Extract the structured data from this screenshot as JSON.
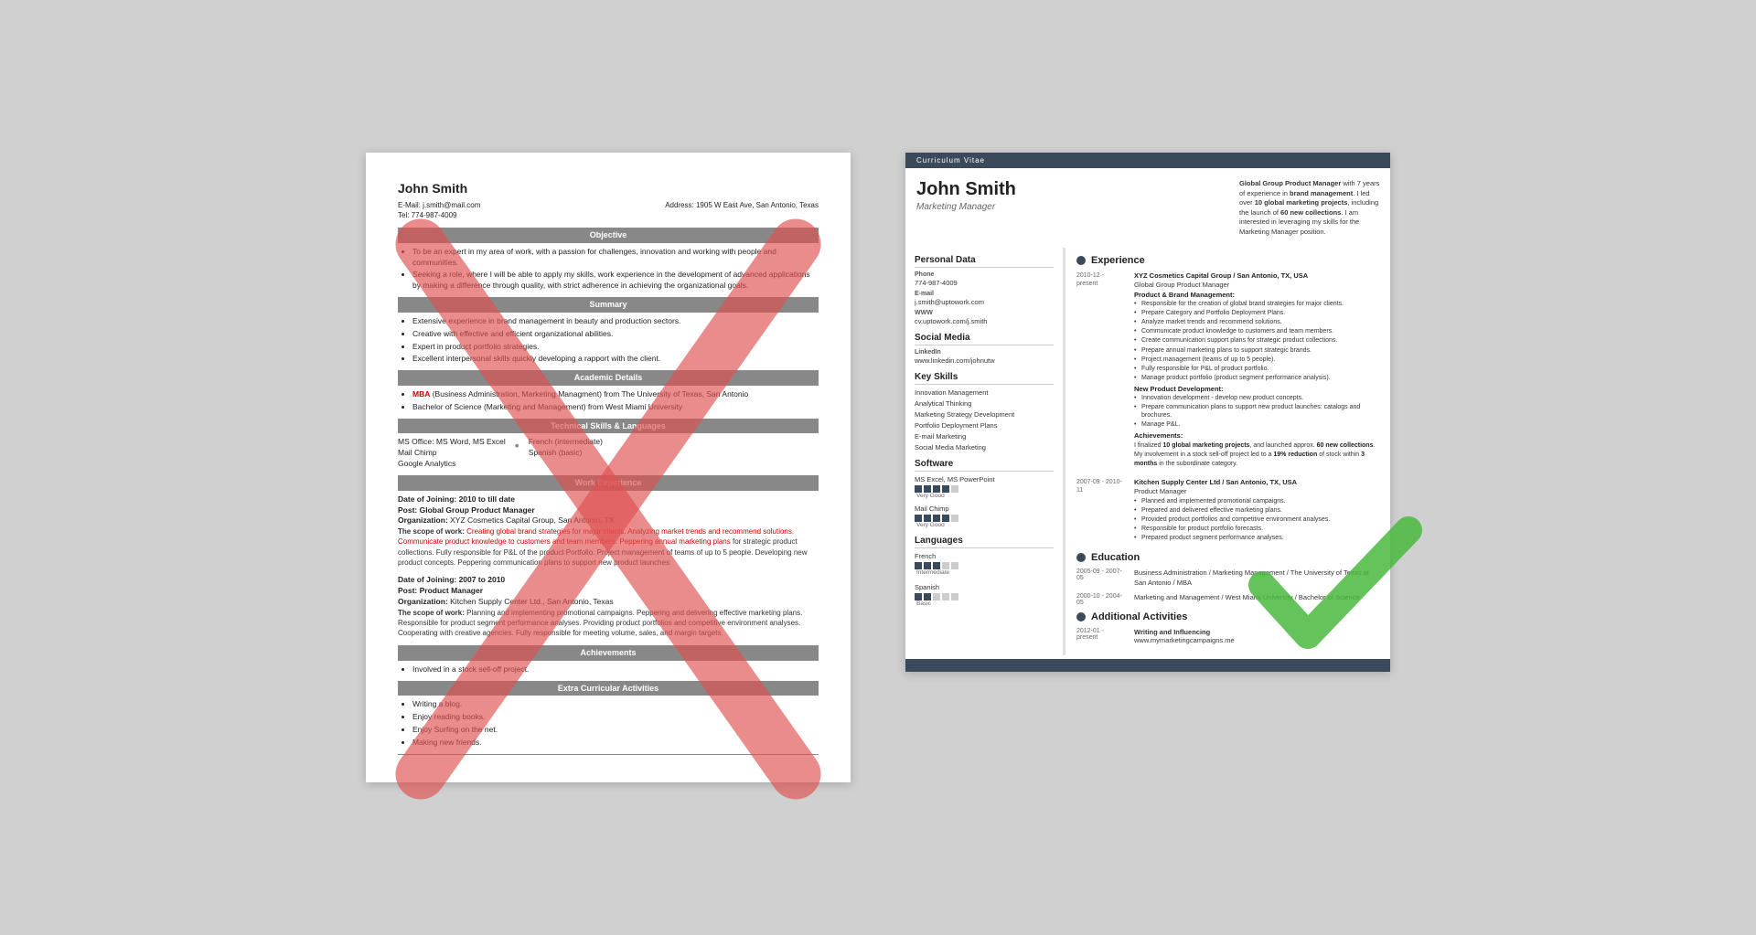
{
  "left": {
    "name": "John Smith",
    "email": "E-Mail: j.smith@mail.com",
    "tel": "Tel: 774-987-4009",
    "address": "Address: 1905 W East Ave, San Antonio, Texas",
    "sections": {
      "objective": "Objective",
      "summary": "Summary",
      "academic": "Academic Details",
      "technical": "Technical Skills & Languages",
      "work": "Work Experience",
      "achievements": "Achievements",
      "extra": "Extra Curricular Activities"
    },
    "objective_bullets": [
      "To be an expert in my area of work, with a passion for challenges, innovation and working with people and communities.",
      "Seeking a role, where I will be able to apply my skills, work experience in the development of advanced applications by making a difference through quality, with strict adherence in achieving the organizational goals."
    ],
    "summary_bullets": [
      "Extensive experience in brand management in beauty and production sectors.",
      "Creative with effective and efficient organizational abilities.",
      "Expert in product portfolio strategies.",
      "Excellent interpersonal skills quickly developing a rapport with the client."
    ],
    "academic_items": [
      {
        "text": "MBA (Business Administration, Marketing Managment) from The University of Texas, San Antonio",
        "highlight": true
      },
      {
        "text": "Bachelor of Science (Marketing and Management) from West Miami University",
        "highlight": false
      }
    ],
    "skills_left": [
      "MS Office: MS Word, MS Excel",
      "Mail Chimp",
      "Google Analytics"
    ],
    "skills_right": [
      "French (intermediate)",
      "Spanish (basic)"
    ],
    "work1": {
      "date": "Date of Joining: 2010 to till date",
      "post": "Post: Global Group Product Manager",
      "org": "Organization: XYZ Cosmetics Capital Group, San Antonio, TX",
      "scope": "The scope of work: Creating global brand strategies for major clients. Analyzing market trends and recommend solutions. Communicate product knowledge to customers and team members. Peppering annual marketing plans for strategic product collections. Fully responsible for P&L of the product Portfolio. Project management of teams of up to 5 people. Developing new product concepts. Peppering communication plans to support new product launches."
    },
    "work2": {
      "date": "Date of Joining: 2007 to 2010",
      "post": "Post: Product Manager",
      "org": "Organization: Kitchen Supply Center Ltd., San Antonio, Texas",
      "scope": "The scope of work: Planning and implementing promotional campaigns. Peppering and delivering effective marketing plans. Responsible for product segment performance analyses. Providing product portfolios and competitive environment analyses. Cooperating with creative agencies. Fully responsible for meeting volume, sales, and margin targets."
    },
    "achieve_text": "Involved in a stock sell-off project.",
    "extra_items": [
      "Writing a blog.",
      "Enjoy reading books.",
      "Enjoy Surfing on the net.",
      "Making new friends."
    ]
  },
  "right": {
    "cv_label": "Curriculum Vitae",
    "name": "John Smith",
    "title": "Marketing Manager",
    "summary": "Global Group Product Manager with 7 years of experience in brand management. I led over 10 global marketing projects, including the launch of 60 new collections. I am interested in leveraging my skills for the Marketing Manager position.",
    "personal": {
      "title": "Personal Data",
      "phone_label": "Phone",
      "phone": "774-987-4009",
      "email_label": "E-mail",
      "email": "j.smith@uptowork.com",
      "www_label": "WWW",
      "www": "cv.uptowork.com/j.smith"
    },
    "social": {
      "title": "Social Media",
      "linkedin_label": "LinkedIn",
      "linkedin": "www.linkedin.com/johnutw"
    },
    "skills": {
      "title": "Key Skills",
      "items": [
        "Innovation Management",
        "Analytical Thinking",
        "Marketing Strategy Development",
        "Portfolio Deployment Plans",
        "E-mail Marketing",
        "Social Media Marketing"
      ]
    },
    "software": {
      "title": "Software",
      "items": [
        {
          "name": "MS Excel, MS PowerPoint",
          "filled": 4,
          "total": 5,
          "label": "Very Good"
        },
        {
          "name": "Mail Chimp",
          "filled": 4,
          "total": 5,
          "label": "Very Good"
        }
      ]
    },
    "languages": {
      "title": "Languages",
      "items": [
        {
          "name": "French",
          "filled": 3,
          "total": 5,
          "label": "Intermediate"
        },
        {
          "name": "Spanish",
          "filled": 2,
          "total": 5,
          "label": "Basic"
        }
      ]
    },
    "experience": {
      "title": "Experience",
      "entries": [
        {
          "dates": "2010-12 - present",
          "company": "XYZ Cosmetics Capital Group / San Antonio, TX, USA",
          "job_title": "Global Group Product Manager",
          "sections": [
            {
              "label": "Product & Brand Management:",
              "bullets": [
                "Responsible for the creation of global brand strategies for major clients.",
                "Prepare Category and Portfolio Deployment Plans.",
                "Analyze market trends and recommend solutions.",
                "Communicate product knowledge to customers and team members.",
                "Create communication support plans for strategic product collections.",
                "Prepare annual marketing plans to support strategic brands.",
                "Project management (teams of up to 5 people).",
                "Fully responsible for P&L of product portfolio.",
                "Manage product portfolio (product segment performance analysis)."
              ]
            },
            {
              "label": "New Product Development:",
              "bullets": [
                "Innovation development - develop new product concepts.",
                "Prepare communication plans to support new product launches: catalogs and brochures.",
                "Manage P&L."
              ]
            }
          ],
          "achievements": "I finalized 10 global marketing projects, and launched approx. 60 new collections.\nMy involvement in a stock sell-off project led to a 19% reduction of stock within 3 months in the subordinate category."
        },
        {
          "dates": "2007-09 - 2010-11",
          "company": "Kitchen Supply Center Ltd / San Antonio, TX, USA",
          "job_title": "Product Manager",
          "bullets": [
            "Planned and implemented promotional campaigns.",
            "Prepared and delivered effective marketing plans.",
            "Provided product portfolios and competitive environment analyses.",
            "Responsible for product portfolio forecasts.",
            "Prepared product segment performance analyses."
          ]
        }
      ]
    },
    "education": {
      "title": "Education",
      "entries": [
        {
          "dates": "2005-09 - 2007-05",
          "text": "Business Administration / Marketing Management / The University of Texas at San Antonio / MBA"
        },
        {
          "dates": "2000-10 - 2004-05",
          "text": "Marketing and Management / West Miami University / Bachelor of Science"
        }
      ]
    },
    "additional": {
      "title": "Additional Activities",
      "entries": [
        {
          "dates": "2012-01 - present",
          "title": "Writing and Influencing",
          "detail": "www.mymarketingcampaigns.me"
        }
      ]
    }
  }
}
